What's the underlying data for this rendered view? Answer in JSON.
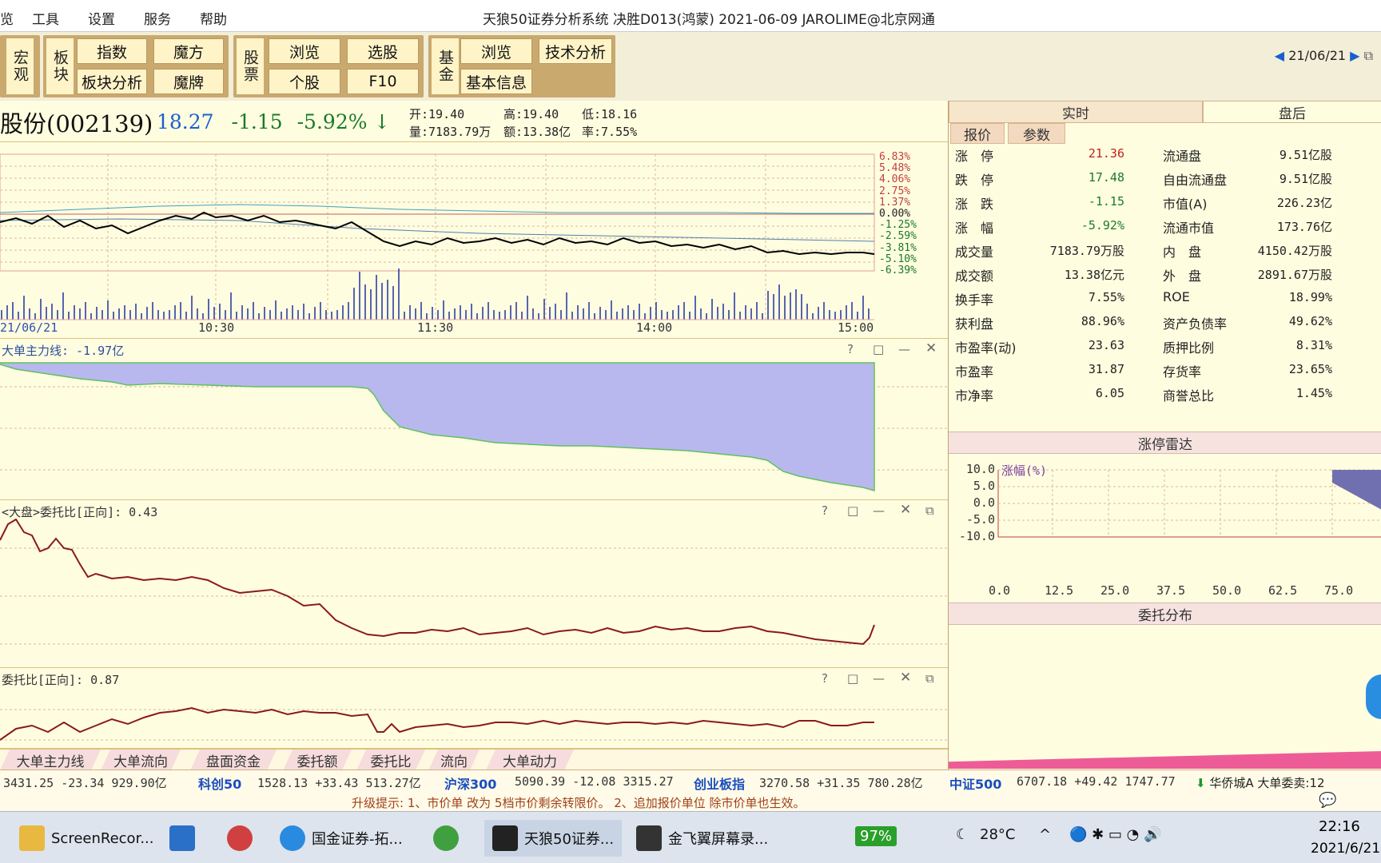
{
  "menubar": {
    "items": [
      "览",
      "工具",
      "设置",
      "服务",
      "帮助"
    ],
    "title": "天狼50证券分析系统  决胜D013(鸿蒙)  2021-06-09 JAROLIME@北京网通"
  },
  "toolbar": {
    "groups": [
      {
        "label": "宏观",
        "buttons": []
      },
      {
        "label": "板块",
        "buttons": [
          "指数",
          "魔方",
          "板块分析",
          "魔牌"
        ]
      },
      {
        "label": "股票",
        "buttons": [
          "浏览",
          "选股",
          "个股",
          "F10"
        ]
      },
      {
        "label": "基金",
        "buttons": [
          "浏览",
          "技术分析",
          "基本信息"
        ]
      }
    ],
    "date_nav": "21/06/21"
  },
  "quote": {
    "name": "股份(002139)",
    "price": "18.27",
    "change": "-1.15",
    "change_pct": "-5.92%",
    "open": "开:19.40",
    "high": "高:19.40",
    "low": "低:18.16",
    "volume": "量:7183.79万",
    "amount": "额:13.38亿",
    "rate": "率:7.55%"
  },
  "intraday": {
    "right_axis": [
      "6.83%",
      "5.48%",
      "4.06%",
      "2.75%",
      "1.37%",
      "0.00%",
      "-1.25%",
      "-2.59%",
      "-3.81%",
      "-5.10%",
      "-6.39%"
    ],
    "time_axis": [
      "21/06/21",
      "10:30",
      "11:30",
      "14:00",
      "15:00"
    ]
  },
  "panels": {
    "p1_title": "大单主力线: -1.97亿",
    "p2_title": "<大盘>委托比[正向]:  0.43",
    "p3_title": "委托比[正向]:  0.87"
  },
  "right": {
    "tab_realtime": "实时",
    "tab_after": "盘后",
    "subtab_quote": "报价",
    "subtab_param": "参数",
    "left_rows": [
      {
        "k": "涨　停",
        "v": "21.36",
        "c": "#c02020"
      },
      {
        "k": "跌　停",
        "v": "17.48",
        "c": "#1a7a2a"
      },
      {
        "k": "涨　跌",
        "v": "-1.15",
        "c": "#1a7a2a"
      },
      {
        "k": "涨　幅",
        "v": "-5.92%",
        "c": "#1a7a2a"
      },
      {
        "k": "成交量",
        "v": "7183.79万股",
        "c": "#222"
      },
      {
        "k": "成交额",
        "v": "13.38亿元",
        "c": "#222"
      },
      {
        "k": "换手率",
        "v": "7.55%",
        "c": "#222"
      },
      {
        "k": "获利盘",
        "v": "88.96%",
        "c": "#222"
      },
      {
        "k": "市盈率(动)",
        "v": "23.63",
        "c": "#222"
      },
      {
        "k": "市盈率",
        "v": "31.87",
        "c": "#222"
      },
      {
        "k": "市净率",
        "v": "6.05",
        "c": "#222"
      }
    ],
    "right_rows": [
      {
        "k": "流通盘",
        "v": "9.51亿股"
      },
      {
        "k": "自由流通盘",
        "v": "9.51亿股"
      },
      {
        "k": "市值(A)",
        "v": "226.23亿"
      },
      {
        "k": "流通市值",
        "v": "173.76亿"
      },
      {
        "k": "内　盘",
        "v": "4150.42万股"
      },
      {
        "k": "外　盘",
        "v": "2891.67万股"
      },
      {
        "k": "ROE",
        "v": "18.99%"
      },
      {
        "k": "资产负债率",
        "v": "49.62%"
      },
      {
        "k": "质押比例",
        "v": "8.31%"
      },
      {
        "k": "存货率",
        "v": "23.65%"
      },
      {
        "k": "商誉总比",
        "v": "1.45%"
      }
    ],
    "radar_title": "涨停雷达",
    "radar_ylabel": "涨幅(%)",
    "radar_yticks": [
      "10.0",
      "5.0",
      "0.0",
      "-5.0",
      "-10.0"
    ],
    "radar_xticks": [
      "0.0",
      "12.5",
      "25.0",
      "37.5",
      "50.0",
      "62.5",
      "75.0"
    ],
    "dist_title": "委托分布"
  },
  "bottom_tabs": [
    "大单主力线",
    "大单流向",
    "盘面资金",
    "委托额",
    "委托比",
    "流向",
    "大单动力"
  ],
  "ticker": {
    "items": [
      {
        "name": "",
        "vals": "3431.25  -23.34  929.90亿"
      },
      {
        "name": "科创50",
        "vals": "1528.13  +33.43  513.27亿"
      },
      {
        "name": "沪深300",
        "vals": "5090.39  -12.08  3315.27"
      },
      {
        "name": "创业板指",
        "vals": "3270.58  +31.35  780.28亿"
      },
      {
        "name": "中证500",
        "vals": "6707.18  +49.42  1747.77"
      }
    ],
    "extra": "华侨城A  大单委卖:12"
  },
  "hint": "升级提示: 1、市价单 改为 5档市价剩余转限价。 2、追加报价单位 除市价单也生效。",
  "taskbar": {
    "tasks": [
      "ScreenRecor...",
      "",
      "",
      "国金证券-拓...",
      "",
      "天狼50证券...",
      "金飞翼屏幕录..."
    ],
    "battery": "97%",
    "weather": "28°C",
    "time": "22:16",
    "date": "2021/6/21"
  },
  "colors": {
    "bg": "#fffde0",
    "price_down": "#1a7a2a",
    "price_up": "#c02020",
    "fill_area": "#b8b8ee",
    "line_red": "#8a1a1a"
  }
}
